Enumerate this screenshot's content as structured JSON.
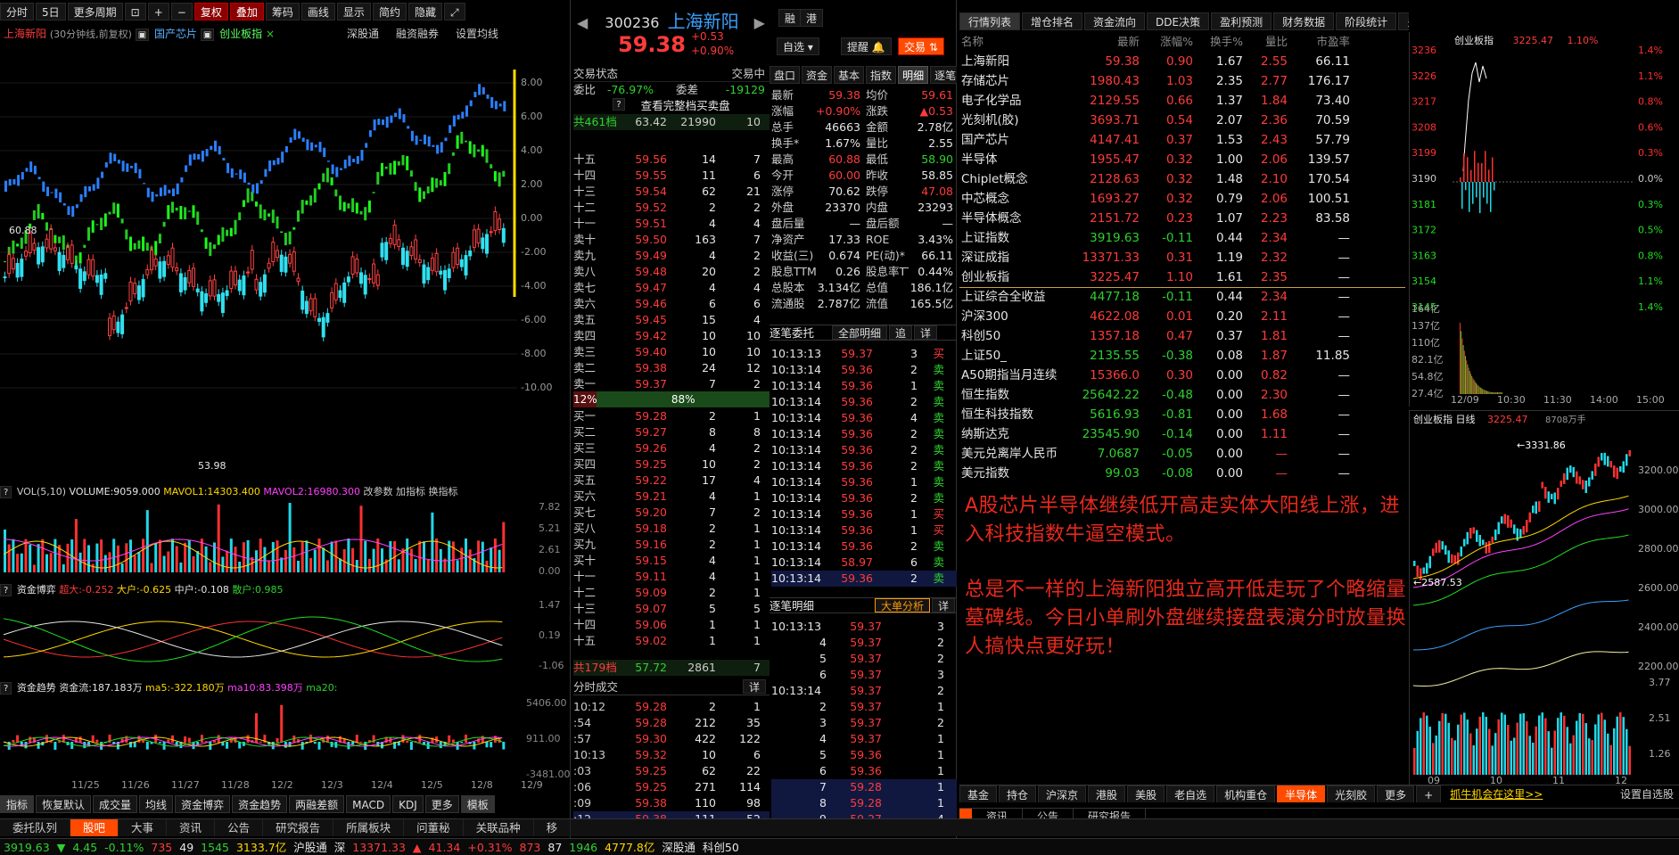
{
  "toolbar": {
    "buttons": [
      "分时",
      "5日",
      "更多周期",
      "复权",
      "叠加",
      "筹码",
      "画线",
      "显示",
      "简约",
      "隐藏"
    ]
  },
  "stock": {
    "code": "300236",
    "name": "上海新阳",
    "price": "59.38",
    "change": "+0.53",
    "pct": "+0.90%",
    "period": "(30分钟线,前复权)",
    "overlay1": "国产芯片",
    "overlay2": "创业板指",
    "links": [
      "深股通",
      "融资融券",
      "设置均线"
    ]
  },
  "kline": {
    "high_label": "60.88",
    "low_label": "53.98",
    "yaxis": [
      "8.00",
      "6.00",
      "4.00",
      "2.00",
      "0.00",
      "-2.00",
      "-4.00",
      "-6.00",
      "-8.00",
      "-10.00"
    ],
    "dates": [
      "11/25",
      "11/26",
      "11/27",
      "11/28",
      "12/2",
      "12/3",
      "12/4",
      "12/5",
      "12/8",
      "12/9"
    ]
  },
  "vol": {
    "label": "VOL(5,10)",
    "volume": "VOLUME:9059.000",
    "m1": "MAVOL1:14303.400",
    "m2": "MAVOL2:16980.300",
    "links": [
      "改参数",
      "加指标",
      "换指标"
    ],
    "yaxis": [
      "7.82",
      "5.21",
      "2.61",
      "0.00"
    ]
  },
  "zjbo": {
    "label": "资金博弈",
    "a": "超大:-0.252",
    "b": "大户:-0.625",
    "c": "中户:-0.108",
    "d": "散户:0.985",
    "yaxis": [
      "1.47",
      "0.19",
      "-1.06"
    ]
  },
  "zjqs": {
    "label": "资金趋势",
    "a": "资金流:187.183万",
    "b": "ma5:-322.180万",
    "c": "ma10:83.398万",
    "d": "ma20:",
    "yaxis": [
      "5406.00",
      "911.00",
      "-3481.00"
    ]
  },
  "ind_tabs": [
    "指标",
    "恢复默认",
    "成交量",
    "均线",
    "资金博弈",
    "资金趋势",
    "两融差额",
    "MACD",
    "KDJ",
    "更多",
    "模板"
  ],
  "mid": {
    "trade_state": "交易状态",
    "trade_state_val": "交易中",
    "wb": "委比",
    "wb_val": "-76.97%",
    "wc": "委差",
    "wc_val": "-19129",
    "full_book": "查看完整档买卖盘",
    "ask_total": "共461档",
    "ask_total_p": "63.42",
    "ask_total_v": "21990",
    "ask_total_n": "10",
    "bid_total": "共179档",
    "bid_total_p": "57.72",
    "bid_total_v": "2861",
    "bid_total_n": "7",
    "ratio_l": "12%",
    "ratio_r": "88%",
    "asks": [
      [
        "十五",
        "59.56",
        "14",
        "7"
      ],
      [
        "十四",
        "59.55",
        "11",
        "6"
      ],
      [
        "十三",
        "59.54",
        "62",
        "21"
      ],
      [
        "十二",
        "59.52",
        "2",
        "2"
      ],
      [
        "十一",
        "59.51",
        "4",
        "4"
      ],
      [
        "卖十",
        "59.50",
        "163",
        "7"
      ],
      [
        "卖九",
        "59.49",
        "4",
        "2"
      ],
      [
        "卖八",
        "59.48",
        "20",
        "2"
      ],
      [
        "卖七",
        "59.47",
        "4",
        "4"
      ],
      [
        "卖六",
        "59.46",
        "6",
        "6"
      ],
      [
        "卖五",
        "59.45",
        "15",
        "4"
      ],
      [
        "卖四",
        "59.42",
        "10",
        "10"
      ],
      [
        "卖三",
        "59.40",
        "10",
        "10"
      ],
      [
        "卖二",
        "59.38",
        "24",
        "12"
      ],
      [
        "卖一",
        "59.37",
        "7",
        "2"
      ]
    ],
    "bids": [
      [
        "买一",
        "59.28",
        "2",
        "1"
      ],
      [
        "买二",
        "59.27",
        "8",
        "8"
      ],
      [
        "买三",
        "59.26",
        "4",
        "2"
      ],
      [
        "买四",
        "59.25",
        "10",
        "2"
      ],
      [
        "买五",
        "59.22",
        "17",
        "4"
      ],
      [
        "买六",
        "59.21",
        "4",
        "1"
      ],
      [
        "买七",
        "59.20",
        "7",
        "2"
      ],
      [
        "买八",
        "59.18",
        "2",
        "1"
      ],
      [
        "买九",
        "59.16",
        "2",
        "1"
      ],
      [
        "买十",
        "59.15",
        "4",
        "1"
      ],
      [
        "十一",
        "59.11",
        "4",
        "1"
      ],
      [
        "十二",
        "59.09",
        "2",
        "1"
      ],
      [
        "十三",
        "59.07",
        "5",
        "5"
      ],
      [
        "十四",
        "59.06",
        "1",
        "1"
      ],
      [
        "十五",
        "59.02",
        "1",
        "1"
      ]
    ],
    "ticks_title": "分时成交",
    "ticks_more": "详",
    "ticks": [
      [
        "10:12",
        "59.28",
        "2",
        "1"
      ],
      [
        ":54",
        "59.28",
        "212",
        "35"
      ],
      [
        ":57",
        "59.30",
        "422",
        "122"
      ],
      [
        "10:13",
        "59.32",
        "10",
        "6"
      ],
      [
        ":03",
        "59.25",
        "62",
        "22"
      ],
      [
        ":06",
        "59.25",
        "271",
        "114"
      ],
      [
        ":09",
        "59.38",
        "110",
        "98"
      ],
      [
        ":12",
        "59.38",
        "111",
        "52"
      ]
    ],
    "tabs": [
      "盘口",
      "资金",
      "基本",
      "指数",
      "明细",
      "逐笔"
    ],
    "xuanzi": "自选",
    "tixing": "提醒",
    "jiaoyi": "交易",
    "stats": [
      [
        "最新",
        "59.38",
        "均价",
        "59.61"
      ],
      [
        "涨幅",
        "+0.90%",
        "涨跌",
        "▲0.53"
      ],
      [
        "总手",
        "46663",
        "金额",
        "2.78亿"
      ],
      [
        "换手*",
        "1.67%",
        "量比",
        "2.55"
      ],
      [
        "最高",
        "60.88",
        "最低",
        "58.90"
      ],
      [
        "今开",
        "60.00",
        "昨收",
        "58.85"
      ],
      [
        "涨停",
        "70.62",
        "跌停",
        "47.08"
      ],
      [
        "外盘",
        "23370",
        "内盘",
        "23293"
      ],
      [
        "盘后量",
        "—",
        "盘后额",
        "—"
      ],
      [
        "净资产",
        "17.33",
        "ROE",
        "3.43%"
      ],
      [
        "收益(三)",
        "0.674",
        "PE(动)*",
        "66.11"
      ],
      [
        "股息TTM",
        "0.26",
        "股息率TTM",
        "0.44%"
      ],
      [
        "总股本",
        "3.134亿",
        "总值",
        "186.1亿"
      ],
      [
        "流通股",
        "2.787亿",
        "流值",
        "165.5亿"
      ]
    ],
    "zbwt_title": "逐笔委托",
    "zbwt_sel": "全部明细",
    "zbwt_btn1": "追",
    "zbwt_btn2": "详",
    "zbwt": [
      [
        "10:13:13",
        "59.37",
        "3",
        "买"
      ],
      [
        "10:13:14",
        "59.36",
        "2",
        "卖"
      ],
      [
        "10:13:14",
        "59.36",
        "1",
        "卖"
      ],
      [
        "10:13:14",
        "59.36",
        "2",
        "卖"
      ],
      [
        "10:13:14",
        "59.36",
        "4",
        "卖"
      ],
      [
        "10:13:14",
        "59.36",
        "2",
        "卖"
      ],
      [
        "10:13:14",
        "59.36",
        "2",
        "卖"
      ],
      [
        "10:13:14",
        "59.36",
        "2",
        "卖"
      ],
      [
        "10:13:14",
        "59.36",
        "1",
        "卖"
      ],
      [
        "10:13:14",
        "59.36",
        "2",
        "卖"
      ],
      [
        "10:13:14",
        "59.36",
        "1",
        "买"
      ],
      [
        "10:13:14",
        "59.36",
        "1",
        "买"
      ],
      [
        "10:13:14",
        "59.36",
        "2",
        "卖"
      ],
      [
        "10:13:14",
        "58.97",
        "6",
        "卖"
      ],
      [
        "10:13:14",
        "59.36",
        "2",
        "卖"
      ]
    ],
    "zbmx_title": "逐笔明细",
    "zbmx_sel": "大单分析",
    "zbmx_btn": "详",
    "zbmx": [
      [
        "10:13:13",
        "59.37",
        "3"
      ],
      [
        "4",
        "59.37",
        "2"
      ],
      [
        "5",
        "59.37",
        "2"
      ],
      [
        "6",
        "59.37",
        "3"
      ],
      [
        "10:13:14",
        "59.37",
        "2"
      ],
      [
        "2",
        "59.37",
        "1"
      ],
      [
        "3",
        "59.37",
        "2"
      ],
      [
        "4",
        "59.37",
        "1"
      ],
      [
        "5",
        "59.36",
        "1"
      ],
      [
        "6",
        "59.36",
        "1"
      ],
      [
        "7",
        "59.28",
        "1"
      ],
      [
        "8",
        "59.28",
        "1"
      ],
      [
        "9",
        "59.27",
        "4"
      ]
    ]
  },
  "right": {
    "tabs": [
      "行情列表",
      "增仓排名",
      "资金流向",
      "DDE决策",
      "盈利预测",
      "财务数据",
      "阶段统计",
      "多股同列"
    ],
    "cols": [
      "名称",
      "最新",
      "涨幅%",
      "换手%",
      "量比",
      "市盈率"
    ],
    "rows": [
      [
        "上海新阳",
        "59.38",
        "0.90",
        "1.67",
        "2.55",
        "66.11"
      ],
      [
        "存储芯片",
        "1980.43",
        "1.03",
        "2.35",
        "2.77",
        "176.17"
      ],
      [
        "电子化学品",
        "2129.55",
        "0.66",
        "1.37",
        "1.84",
        "73.40"
      ],
      [
        "光刻机(胶)",
        "3693.71",
        "0.54",
        "2.07",
        "2.36",
        "70.59"
      ],
      [
        "国产芯片",
        "4147.41",
        "0.37",
        "1.53",
        "2.43",
        "57.79"
      ],
      [
        "半导体",
        "1955.47",
        "0.32",
        "1.00",
        "2.06",
        "139.57"
      ],
      [
        "Chiplet概念",
        "2128.63",
        "0.32",
        "1.48",
        "2.10",
        "170.54"
      ],
      [
        "中芯概念",
        "1693.27",
        "0.32",
        "0.79",
        "2.06",
        "100.51"
      ],
      [
        "半导体概念",
        "2151.72",
        "0.23",
        "1.07",
        "2.23",
        "83.58"
      ],
      [
        "上证指数",
        "3919.63",
        "-0.11",
        "0.44",
        "2.34",
        "—"
      ],
      [
        "深证成指",
        "13371.33",
        "0.31",
        "1.19",
        "2.32",
        "—"
      ],
      [
        "创业板指",
        "3225.47",
        "1.10",
        "1.61",
        "2.35",
        "—"
      ]
    ],
    "rows2": [
      [
        "上证综合全收益",
        "4477.18",
        "-0.11",
        "0.44",
        "2.34",
        "—"
      ],
      [
        "沪深300",
        "4622.08",
        "0.01",
        "0.20",
        "2.11",
        "—"
      ],
      [
        "科创50",
        "1357.18",
        "0.47",
        "0.37",
        "1.81",
        "—"
      ],
      [
        "上证50_",
        "2135.55",
        "-0.38",
        "0.08",
        "1.87",
        "11.85"
      ],
      [
        "A50期指当月连续",
        "15366.0",
        "0.30",
        "0.00",
        "0.82",
        "—"
      ],
      [
        "恒生指数",
        "25642.22",
        "-0.48",
        "0.00",
        "2.30",
        "—"
      ],
      [
        "恒生科技指数",
        "5616.93",
        "-0.81",
        "0.00",
        "1.68",
        "—"
      ],
      [
        "纳斯达克",
        "23545.90",
        "-0.14",
        "0.00",
        "1.11",
        "—"
      ],
      [
        "美元兑离岸人民币",
        "7.0687",
        "-0.05",
        "0.00",
        "—",
        "—"
      ],
      [
        "美元指数",
        "99.03",
        "-0.08",
        "0.00",
        "—",
        "—"
      ]
    ],
    "note1": "A股芯片半导体继续低开高走实体大阳线上涨，进入科技指数牛逼空模式。",
    "note2": "总是不一样的上海新阳独立高开低走玩了个略缩量墓碑线。今日小单刷外盘继续接盘表演分时放量换人搞快点更好玩！",
    "mini_title": "创业板指",
    "mini_price": "3225.47",
    "mini_pct": "1.10%",
    "mini_y": [
      "3236",
      "3226",
      "3217",
      "3208",
      "3199",
      "3190",
      "3181",
      "3172",
      "3163",
      "3154",
      "3145"
    ],
    "mini_p": [
      "1.4%",
      "1.1%",
      "0.8%",
      "0.6%",
      "0.3%",
      "0.0%",
      "0.3%",
      "0.5%",
      "0.8%",
      "1.1%",
      "1.4%"
    ],
    "mini_v": [
      "164亿",
      "137亿",
      "110亿",
      "82.1亿",
      "54.8亿",
      "27.4亿"
    ],
    "mini_t": [
      "12/09",
      "10:30",
      "11:30",
      "14:00",
      "15:00"
    ],
    "daily_title": "创业板指 日线",
    "daily_price": "3225.47",
    "daily_vol": "8708万手",
    "daily_hi": "3331.86",
    "daily_lo": "2587.53",
    "daily_y": [
      "3200.00",
      "3000.00",
      "2800.00",
      "2600.00",
      "2400.00",
      "2200.00"
    ],
    "daily_v": [
      "3.77",
      "2.51",
      "1.26"
    ],
    "daily_x": [
      "09",
      "10",
      "11",
      "12"
    ],
    "bot_tabs": [
      "基金",
      "持仓",
      "沪深京",
      "港股",
      "美股",
      "老自选",
      "机构重仓",
      "半导体",
      "光刻胶",
      "更多",
      "+"
    ],
    "promo": "抓牛机会在这里>>",
    "settings": "设置自选股",
    "sub_tabs": [
      "资讯",
      "公告",
      "研究报告"
    ]
  },
  "bottom_tabs": [
    "委托队列",
    "股吧",
    "大事",
    "资讯",
    "公告",
    "研究报告",
    "所属板块",
    "问董秘",
    "关联品种",
    "移"
  ],
  "status": [
    "3919.63",
    "▼",
    "4.45",
    "-0.11%",
    "735",
    "49",
    "1545",
    "3133.7亿",
    "沪股通",
    "深",
    "13371.33",
    "▲",
    "41.34",
    "+0.31%",
    "873",
    "87",
    "1946",
    "4777.8亿",
    "深股通",
    "科创50"
  ]
}
